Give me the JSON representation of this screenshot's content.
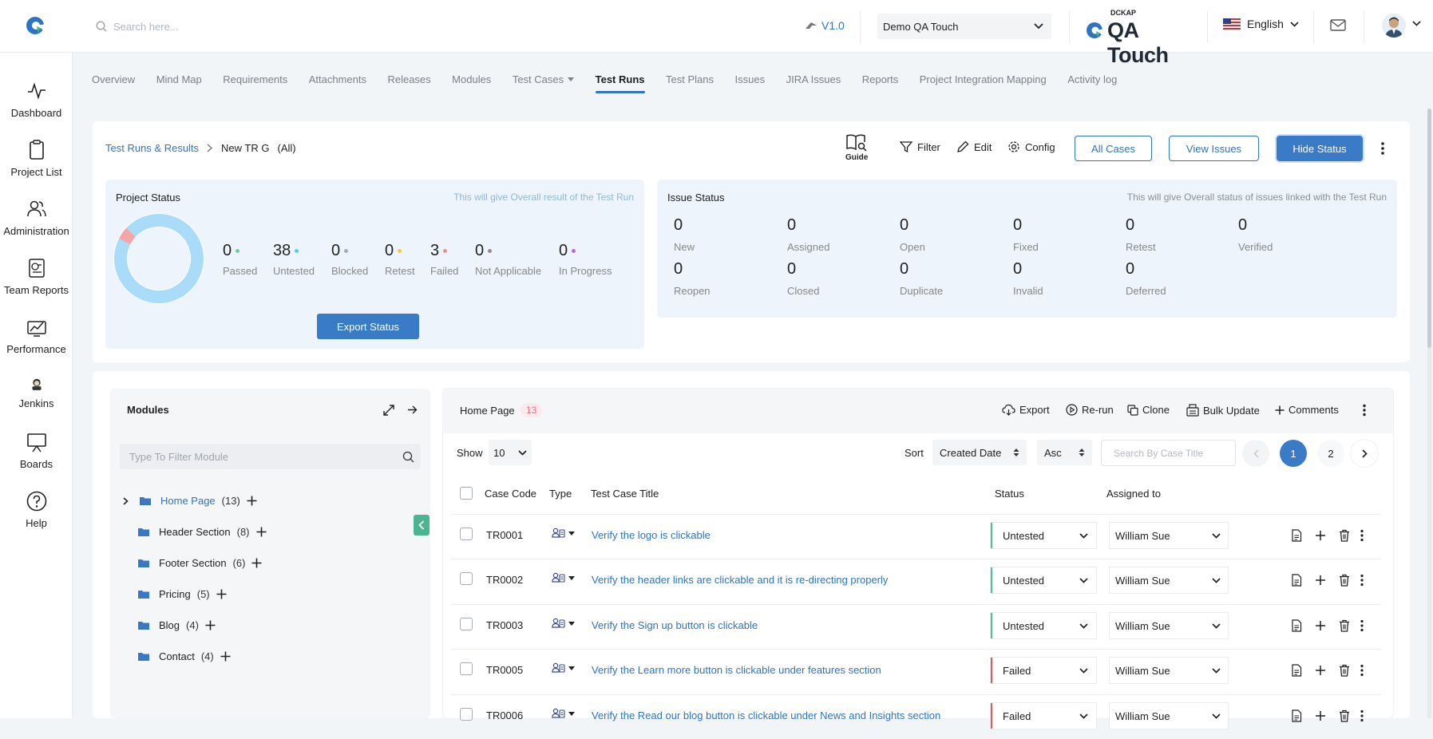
{
  "search": {
    "placeholder": "Search here..."
  },
  "version": "V1.0",
  "project_select": "Demo QA Touch",
  "brand": {
    "top": "DCKAP",
    "main": "QA Touch"
  },
  "language": "English",
  "sidebar": {
    "items": [
      {
        "label": "Dashboard",
        "icon": "pulse-icon"
      },
      {
        "label": "Project List",
        "icon": "clipboard-icon"
      },
      {
        "label": "Administration",
        "icon": "users-icon"
      },
      {
        "label": "Team Reports",
        "icon": "report-icon"
      },
      {
        "label": "Performance",
        "icon": "performance-icon"
      },
      {
        "label": "Jenkins",
        "icon": "jenkins-icon"
      },
      {
        "label": "Boards",
        "icon": "board-icon"
      },
      {
        "label": "Help",
        "icon": "help-icon"
      }
    ]
  },
  "tabs": [
    {
      "label": "Overview"
    },
    {
      "label": "Mind Map"
    },
    {
      "label": "Requirements"
    },
    {
      "label": "Attachments"
    },
    {
      "label": "Releases"
    },
    {
      "label": "Modules"
    },
    {
      "label": "Test Cases"
    },
    {
      "label": "Test Runs",
      "active": true
    },
    {
      "label": "Test Plans"
    },
    {
      "label": "Issues"
    },
    {
      "label": "JIRA Issues"
    },
    {
      "label": "Reports"
    },
    {
      "label": "Project Integration Mapping"
    },
    {
      "label": "Activity log"
    }
  ],
  "breadcrumb": {
    "parent": "Test Runs & Results",
    "current": "New TR G",
    "scope": "(All)"
  },
  "toolbar": {
    "guide": "Guide",
    "filter": "Filter",
    "edit": "Edit",
    "config": "Config",
    "all_cases": "All Cases",
    "view_issues": "View Issues",
    "hide_status": "Hide Status"
  },
  "project_status": {
    "title": "Project Status",
    "hint": "This will give Overall result of the Test Run",
    "stats": [
      {
        "value": "0",
        "label": "Passed",
        "color": "#6fcf97"
      },
      {
        "value": "38",
        "label": "Untested",
        "color": "#56ccf2"
      },
      {
        "value": "0",
        "label": "Blocked",
        "color": "#a8adb5"
      },
      {
        "value": "0",
        "label": "Retest",
        "color": "#f2c94c"
      },
      {
        "value": "3",
        "label": "Failed",
        "color": "#eb8f8f"
      },
      {
        "value": "0",
        "label": "Not Applicable",
        "color": "#a1887f"
      },
      {
        "value": "0",
        "label": "In Progress",
        "color": "#bb6bd9"
      }
    ],
    "export_label": "Export Status"
  },
  "issue_status": {
    "title": "Issue Status",
    "hint": "This will give Overall status of issues linked with the Test Run",
    "stats": [
      {
        "value": "0",
        "label": "New"
      },
      {
        "value": "0",
        "label": "Assigned"
      },
      {
        "value": "0",
        "label": "Open"
      },
      {
        "value": "0",
        "label": "Fixed"
      },
      {
        "value": "0",
        "label": "Retest"
      },
      {
        "value": "0",
        "label": "Verified"
      },
      {
        "value": "0",
        "label": "Reopen"
      },
      {
        "value": "0",
        "label": "Closed"
      },
      {
        "value": "0",
        "label": "Duplicate"
      },
      {
        "value": "0",
        "label": "Invalid"
      },
      {
        "value": "0",
        "label": "Deferred"
      }
    ]
  },
  "modules": {
    "title": "Modules",
    "filter_placeholder": "Type To Filter Module",
    "tree": [
      {
        "name": "Home Page",
        "count": "(13)",
        "selected": true
      },
      {
        "name": "Header Section",
        "count": "(8)"
      },
      {
        "name": "Footer Section",
        "count": "(6)"
      },
      {
        "name": "Pricing",
        "count": "(5)"
      },
      {
        "name": "Blog",
        "count": "(4)"
      },
      {
        "name": "Contact",
        "count": "(4)"
      }
    ]
  },
  "cases": {
    "section_title": "Home Page",
    "section_count": "13",
    "tools": {
      "export": "Export",
      "rerun": "Re-run",
      "clone": "Clone",
      "bulk_update": "Bulk Update",
      "comments": "Comments"
    },
    "show_label": "Show",
    "show_value": "10",
    "sort_label": "Sort",
    "sort_field": "Created Date",
    "sort_dir": "Asc",
    "search_placeholder": "Search By Case Title",
    "pages": [
      "1",
      "2"
    ],
    "current_page": "1",
    "columns": {
      "code": "Case Code",
      "type": "Type",
      "title": "Test Case Title",
      "status": "Status",
      "assigned": "Assigned to"
    },
    "rows": [
      {
        "code": "TR0001",
        "title": "Verify the logo is clickable",
        "status": "Untested",
        "status_color": "#4fc3a1",
        "assignee": "William Sue"
      },
      {
        "code": "TR0002",
        "title": "Verify the header links are clickable and it is re-directing properly",
        "status": "Untested",
        "status_color": "#4fc3a1",
        "assignee": "William Sue"
      },
      {
        "code": "TR0003",
        "title": "Verify the Sign up button is clickable",
        "status": "Untested",
        "status_color": "#4fc3a1",
        "assignee": "William Sue"
      },
      {
        "code": "TR0005",
        "title": "Verify the Learn more button is clickable under features section",
        "status": "Failed",
        "status_color": "#e05a5a",
        "assignee": "William Sue"
      },
      {
        "code": "TR0006",
        "title": "Verify the Read our blog button is clickable under News and Insights section",
        "status": "Failed",
        "status_color": "#e05a5a",
        "assignee": "William Sue"
      }
    ]
  },
  "colors": {
    "accent": "#2f74c0",
    "donut_untested": "#9ed8f7",
    "donut_failed": "#f4a6a6"
  }
}
